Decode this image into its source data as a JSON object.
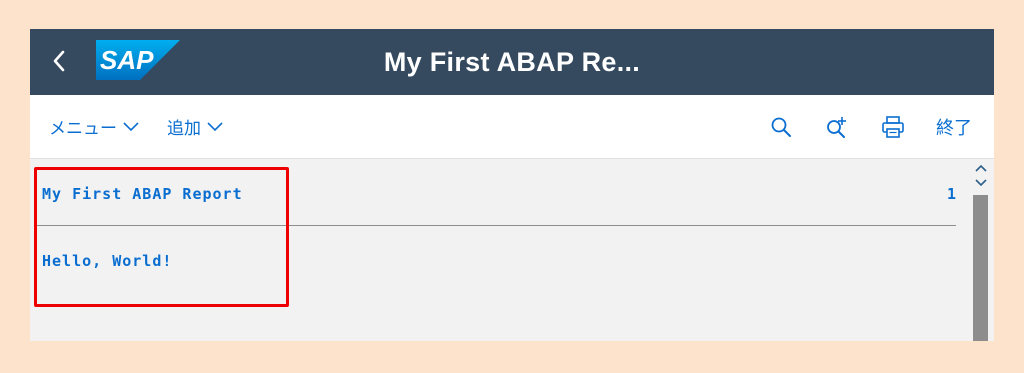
{
  "shell": {
    "title": "My First ABAP Re...",
    "logo_text": "SAP"
  },
  "toolbar": {
    "menu_label": "メニュー",
    "add_label": "追加",
    "exit_label": "終了",
    "icons": [
      "search-icon",
      "search-plus-icon",
      "print-icon"
    ]
  },
  "report": {
    "heading": "My First ABAP Report",
    "page_number": "1",
    "body_line": "Hello, World!"
  },
  "colors": {
    "shell_bg": "#354a5f",
    "accent": "#0a6ed1",
    "highlight": "#ee0000",
    "page_bg": "#fde3cb"
  }
}
